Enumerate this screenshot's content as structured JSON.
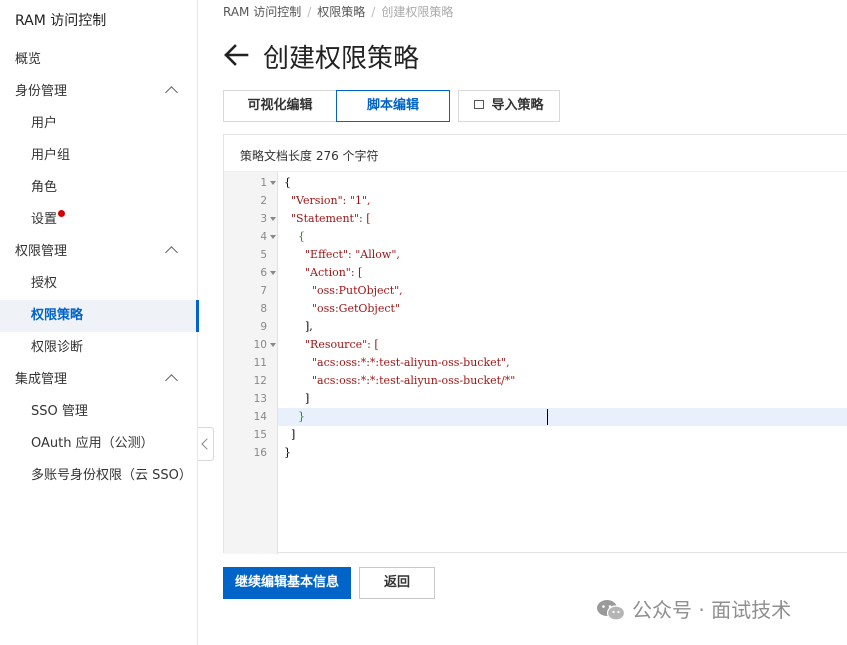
{
  "sidebar": {
    "title": "RAM 访问控制",
    "items": [
      {
        "label": "概览",
        "level": "top"
      },
      {
        "label": "身份管理",
        "level": "top",
        "expandable": true
      },
      {
        "label": "用户",
        "level": "sub"
      },
      {
        "label": "用户组",
        "level": "sub"
      },
      {
        "label": "角色",
        "level": "sub"
      },
      {
        "label": "设置",
        "level": "sub",
        "badge": "red-dot"
      },
      {
        "label": "权限管理",
        "level": "top",
        "expandable": true
      },
      {
        "label": "授权",
        "level": "sub"
      },
      {
        "label": "权限策略",
        "level": "sub",
        "active": true
      },
      {
        "label": "权限诊断",
        "level": "sub"
      },
      {
        "label": "集成管理",
        "level": "top",
        "expandable": true
      },
      {
        "label": "SSO 管理",
        "level": "sub"
      },
      {
        "label": "OAuth 应用（公测）",
        "level": "sub"
      },
      {
        "label": "多账号身份权限（云 SSO）",
        "level": "sub"
      }
    ]
  },
  "breadcrumb": [
    "RAM 访问控制",
    "权限策略",
    "创建权限策略"
  ],
  "page": {
    "title": "创建权限策略",
    "back_icon": "arrow-left-icon"
  },
  "tabs": [
    {
      "label": "可视化编辑",
      "selected": false
    },
    {
      "label": "脚本编辑",
      "selected": true
    },
    {
      "label": "导入策略",
      "selected": false,
      "icon": "import-icon"
    }
  ],
  "editor": {
    "doc_length": "策略文档长度 276 个字符",
    "lines": [
      {
        "n": "1",
        "text": "{"
      },
      {
        "n": "2",
        "text": "  \"Version\": \"1\","
      },
      {
        "n": "3",
        "text": "  \"Statement\": ["
      },
      {
        "n": "4",
        "text": "    {"
      },
      {
        "n": "5",
        "text": "      \"Effect\": \"Allow\","
      },
      {
        "n": "6",
        "text": "      \"Action\": ["
      },
      {
        "n": "7",
        "text": "        \"oss:PutObject\","
      },
      {
        "n": "8",
        "text": "        \"oss:GetObject\""
      },
      {
        "n": "9",
        "text": "      ],"
      },
      {
        "n": "10",
        "text": "      \"Resource\": ["
      },
      {
        "n": "11",
        "text": "        \"acs:oss:*:*:test-aliyun-oss-bucket\","
      },
      {
        "n": "12",
        "text": "        \"acs:oss:*:*:test-aliyun-oss-bucket/*\""
      },
      {
        "n": "13",
        "text": "      ]"
      },
      {
        "n": "14",
        "text": "    }"
      },
      {
        "n": "15",
        "text": "  ]"
      },
      {
        "n": "16",
        "text": "}"
      }
    ],
    "active_line": "14"
  },
  "actions": {
    "primary": "继续编辑基本信息",
    "secondary": "返回"
  },
  "watermark": "公众号 · 面试技术",
  "colors": {
    "accent": "#0064c8",
    "badge": "#d40000",
    "string": "#a31515"
  }
}
